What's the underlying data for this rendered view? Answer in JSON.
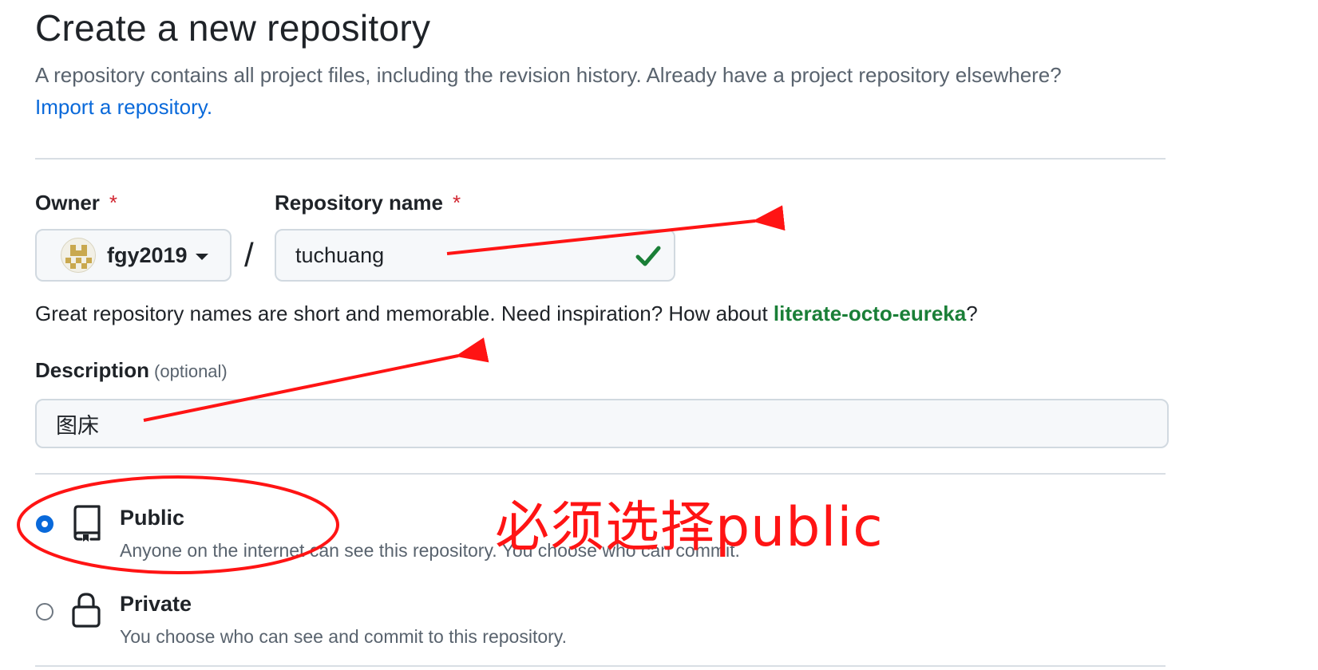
{
  "header": {
    "title": "Create a new repository",
    "subtitle": "A repository contains all project files, including the revision history. Already have a project repository elsewhere?",
    "import_link": "Import a repository."
  },
  "owner": {
    "label": "Owner",
    "required_mark": "*",
    "value": "fgy2019"
  },
  "separator": "/",
  "repo_name": {
    "label": "Repository name",
    "required_mark": "*",
    "value": "tuchuang",
    "valid": true
  },
  "hint": {
    "text": "Great repository names are short and memorable. Need inspiration? How about ",
    "suggestion": "literate-octo-eureka",
    "suffix": "?"
  },
  "description": {
    "label": "Description",
    "optional": "(optional)",
    "value": "图床"
  },
  "visibility": {
    "public": {
      "title": "Public",
      "desc": "Anyone on the internet can see this repository. You choose who can commit.",
      "checked": true
    },
    "private": {
      "title": "Private",
      "desc": "You choose who can see and commit to this repository.",
      "checked": false
    }
  },
  "annotation": {
    "text": "必须选择public",
    "color": "#ff1414"
  },
  "colors": {
    "link": "#0969da",
    "suggestion": "#1a7f37",
    "required": "#d1242f",
    "check": "#1a7f37"
  }
}
